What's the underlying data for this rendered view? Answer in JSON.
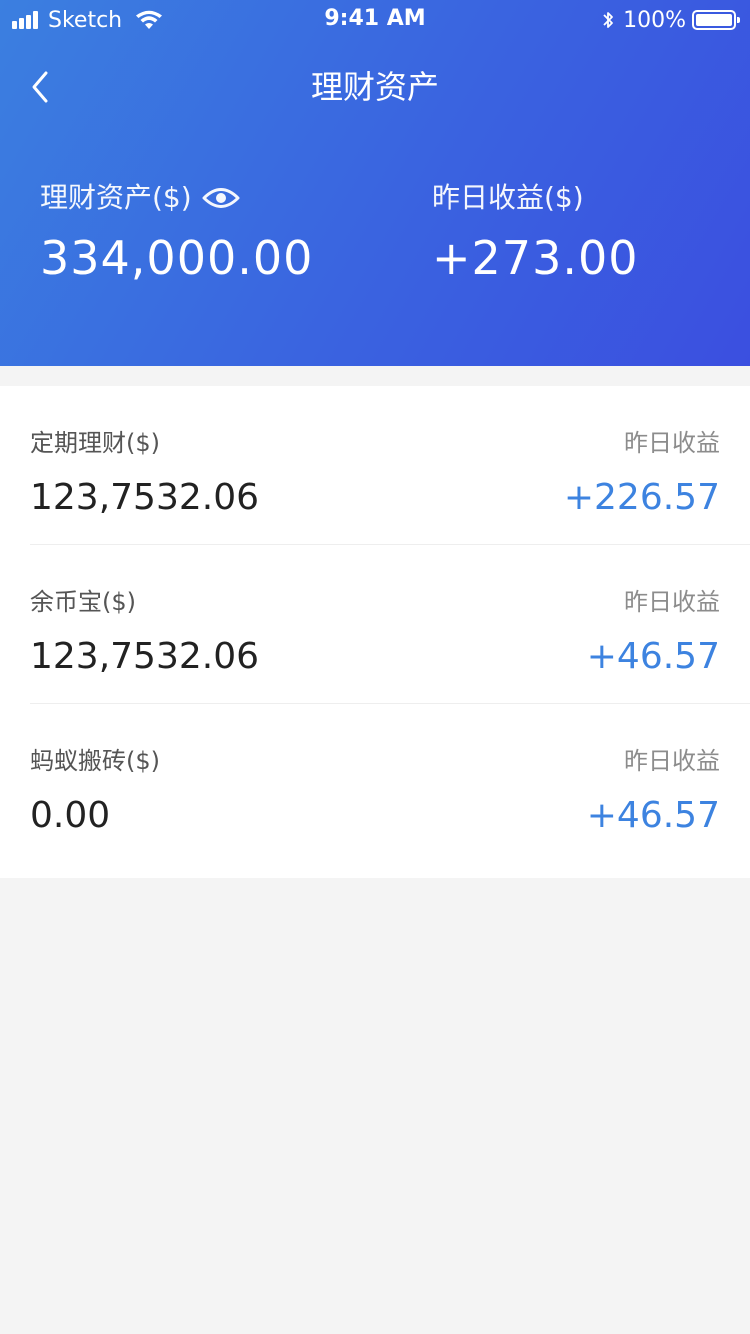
{
  "status_bar": {
    "carrier": "Sketch",
    "time": "9:41 AM",
    "battery_percent": "100%",
    "battery_level": 1.0
  },
  "nav": {
    "title": "理财资产",
    "back_icon": "chevron-left-icon"
  },
  "summary": {
    "assets_label": "理财资产($)",
    "assets_value": "334,000.00",
    "eye_icon": "eye-icon",
    "yesterday_label": "昨日收益($)",
    "yesterday_value": "+273.00"
  },
  "items": [
    {
      "name": "定期理财($)",
      "amount": "123,7532.06",
      "yesterday_label": "昨日收益",
      "yesterday_value": "+226.57"
    },
    {
      "name": "余币宝($)",
      "amount": "123,7532.06",
      "yesterday_label": "昨日收益",
      "yesterday_value": "+46.57"
    },
    {
      "name": "蚂蚁搬砖($)",
      "amount": "0.00",
      "yesterday_label": "昨日收益",
      "yesterday_value": "+46.57"
    }
  ],
  "colors": {
    "header_gradient_start": "#3b7fe0",
    "header_gradient_end": "#3b4fe0",
    "accent_blue": "#3d83e0",
    "page_background": "#f4f4f4"
  }
}
